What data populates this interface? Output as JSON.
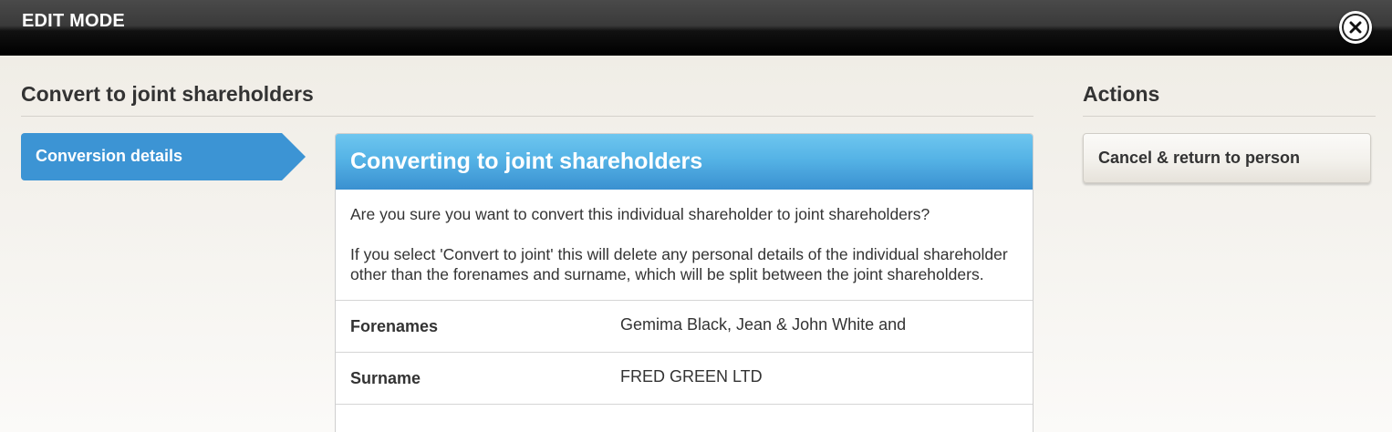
{
  "topbar": {
    "title": "EDIT MODE",
    "close_icon": "close-icon"
  },
  "main": {
    "heading": "Convert to joint shareholders",
    "step_tab": "Conversion details",
    "panel": {
      "title": "Converting to joint shareholders",
      "question": "Are you sure you want to convert this individual shareholder to joint shareholders?",
      "warning": "If you select 'Convert to joint' this will delete any personal details of the individual shareholder other than the forenames and surname, which will be split between the joint shareholders.",
      "rows": [
        {
          "label": "Forenames",
          "value": "Gemima Black, Jean & John White and"
        },
        {
          "label": "Surname",
          "value": "FRED GREEN LTD"
        }
      ]
    }
  },
  "actions": {
    "heading": "Actions",
    "cancel_label": "Cancel & return to person"
  },
  "colors": {
    "accent": "#3c94d4",
    "topbar": "#000000"
  }
}
